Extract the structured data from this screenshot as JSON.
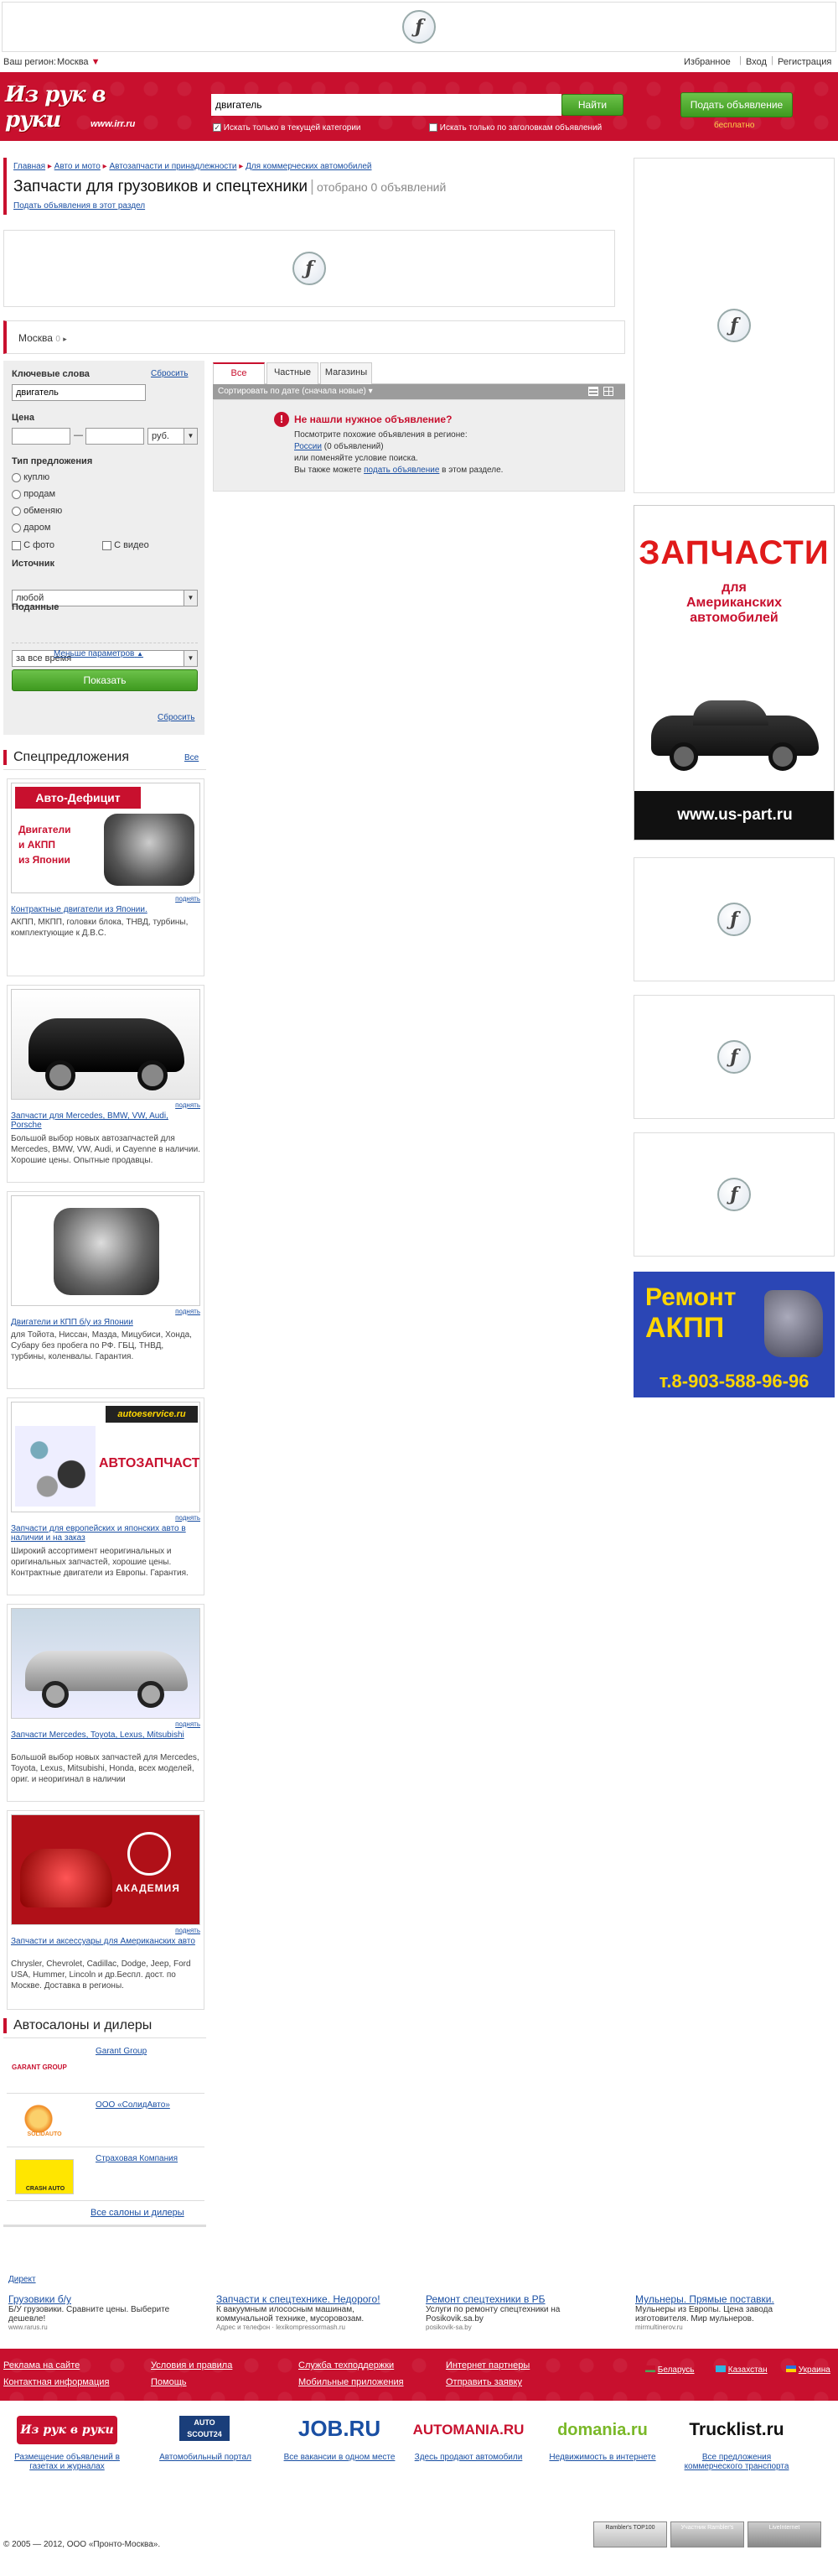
{
  "top_banner": {
    "icon": "flash-icon"
  },
  "topbar": {
    "region_label": "Ваш регион:",
    "region_value": "Москва",
    "favorites": "Избранное",
    "login": "Вход",
    "register": "Регистрация"
  },
  "header": {
    "logo_text": "Из рук в руки",
    "logo_url": "www.irr.ru",
    "search_value": "двигатель",
    "search_button": "Найти",
    "check_category": "Искать только в текущей категории",
    "check_titles": "Искать только по заголовкам объявлений",
    "post_button": "Подать объявление",
    "post_free": "бесплатно"
  },
  "breadcrumb": [
    "Главная",
    "Авто и мото",
    "Автозапчасти и принадлежности",
    "Для коммерческих автомобилей"
  ],
  "page": {
    "title": "Запчасти для грузовиков и спецтехники",
    "count": "отобрано 0 объявлений",
    "post_link": "Подать объявления в этот раздел"
  },
  "location": {
    "city": "Москва",
    "count": "0"
  },
  "filters": {
    "keywords_label": "Ключевые слова",
    "reset_top": "Сбросить",
    "keywords_value": "двигатель",
    "price_label": "Цена",
    "price_dash": "—",
    "currency": "руб.",
    "offer_type_label": "Тип предложения",
    "offer_types": [
      "куплю",
      "продам",
      "обменяю",
      "даром"
    ],
    "with_photo": "С фото",
    "with_video": "С видео",
    "source_label": "Источник",
    "source_value": "любой",
    "posted_label": "Поданные",
    "posted_value": "за все время",
    "fewer_params": "Меньше параметров",
    "show_button": "Показать",
    "reset_bottom": "Сбросить"
  },
  "results": {
    "tabs": [
      "Все объявления",
      "Частные",
      "Магазины"
    ],
    "sort_label": "Сортировать по дате (сначала новые)",
    "notfound_title": "Не нашли нужное объявление?",
    "notfound_line1": "Посмотрите похожие объявления в регионе:",
    "notfound_region": "России",
    "notfound_region_count": " (0 объявлений)",
    "notfound_line3": "или поменяйте условие поиска.",
    "notfound_line4_pre": "Вы также можете ",
    "notfound_line4_link": "подать объявление",
    "notfound_line4_post": " в этом разделе."
  },
  "special": {
    "title": "Спецпредложения",
    "all_link": "Все",
    "raise": "поднять",
    "items": [
      {
        "link": "Контрактные двигатели из Японии.",
        "text": "АКПП, МКПП, головки блока, ТНВД, турбины, комплектующие к Д.В.С.",
        "banner_title": "Авто-Дефицит",
        "banner_lines": [
          "Двигатели",
          "и АКПП",
          "из Японии"
        ]
      },
      {
        "link": "Запчасти для Mercedes, BMW, VW, Audi, Porsche",
        "text": "Большой выбор новых автозапчастей для Mercedes, BMW, VW, Audi, и Cayenne в наличии. Хорошие цены. Опытные продавцы."
      },
      {
        "link": "Двигатели и КПП б/у из Японии",
        "text": "для Тойота, Ниссан, Мазда, Мицубиси, Хонда, Субару без пробега по РФ. ГБЦ, ТНВД, турбины, коленвалы. Гарантия."
      },
      {
        "link": "Запчасти для европейских и японских авто в наличии и на заказ",
        "text": "Широкий ассортимент неоригинальных и оригинальных запчастей, хорошие цены. Контрактные двигатели из Европы. Гарантия.",
        "banner_brand": "autoeservice.ru",
        "banner_title": "АВТОЗАПЧАСТИ"
      },
      {
        "link": "Запчасти Mercedes, Toyota, Lexus, Mitsubishi",
        "text": "Большой выбор новых запчастей для Mercedes, Toyota, Lexus, Mitsubishi, Honda, всех моделей, ориг. и неоригинал в наличии"
      },
      {
        "link": "Запчасти и аксессуары для Американских авто",
        "text": "Chrysler, Chevrolet, Cadillac, Dodge, Jeep, Ford USA, Hummer, Lincoln и др.Беспл. дост. по Москве. Доставка в регионы.",
        "banner_title": "АКАДЕМИЯ"
      }
    ]
  },
  "dealers": {
    "title": "Автосалоны и дилеры",
    "items": [
      {
        "name": "Garant Group",
        "logo": "GARANT GROUP"
      },
      {
        "name": "ООО «СолидАвто»",
        "logo": "SOLIDAUTO"
      },
      {
        "name": "Страховая Компания",
        "logo": "CRASH AUTO"
      }
    ],
    "all_link": "Все салоны и дилеры"
  },
  "right_ads": {
    "ad1_title": "ЗАПЧАСТИ",
    "ad1_sub1": "для",
    "ad1_sub2": "Американских",
    "ad1_sub3": "автомобилей",
    "ad1_url": "www.us-part.ru",
    "ad2_line1": "Ремонт",
    "ad2_line2": "АКПП",
    "ad2_phone": "т.8-903-588-96-96"
  },
  "direct": {
    "label": "Директ",
    "ads": [
      {
        "title": "Грузовики б/у",
        "text": "Б/У грузовики. Сравните цены. Выберите дешевле!",
        "url": "www.rarus.ru"
      },
      {
        "title": "Запчасти к спецтехнике. Недорого!",
        "text": "К вакуумным илососным машинам, коммунальной технике, мусоровозам.",
        "url": "Адрес и телефон · lexikompressormash.ru"
      },
      {
        "title": "Ремонт спецтехники в РБ",
        "text": "Услуги по ремонту спецтехники на Posikovik.sa.by",
        "url": "posikovik-sa.by"
      },
      {
        "title": "Мульнеры. Прямые поставки.",
        "text": "Мульнеры из Европы. Цена завода изготовителя. Мир мульнеров.",
        "url": "mirmultinerov.ru"
      }
    ]
  },
  "footer": {
    "col1": [
      "Реклама на сайте",
      "Контактная информация"
    ],
    "col2": [
      "Условия и правила",
      "Помощь"
    ],
    "col3": [
      "Служба техподдержки",
      "Мобильные приложения"
    ],
    "col4": [
      "Интернет партнеры",
      "Отправить заявку"
    ],
    "regions": [
      "Беларусь",
      "Казахстан",
      "Украина"
    ]
  },
  "partners": [
    {
      "logo": "Из рук в руки",
      "caption": "Размещение объявлений в газетах и журналах"
    },
    {
      "logo": "AUTO SCOUT24",
      "caption": "Автомобильный портал"
    },
    {
      "logo": "JOB.RU",
      "caption": "Все вакансии в одном месте"
    },
    {
      "logo": "AUTOMANIA.RU",
      "caption": "Здесь продают автомобили"
    },
    {
      "logo": "domania.ru",
      "caption": "Недвижимость в интернете"
    },
    {
      "logo": "Trucklist.ru",
      "caption": "Все предложения коммерческого транспорта"
    }
  ],
  "copyright": "© 2005 — 2012, ООО «Пронто-Москва».",
  "counters": [
    "Rambler's TOP100",
    "Участник Rambler's",
    "LiveInternet"
  ]
}
